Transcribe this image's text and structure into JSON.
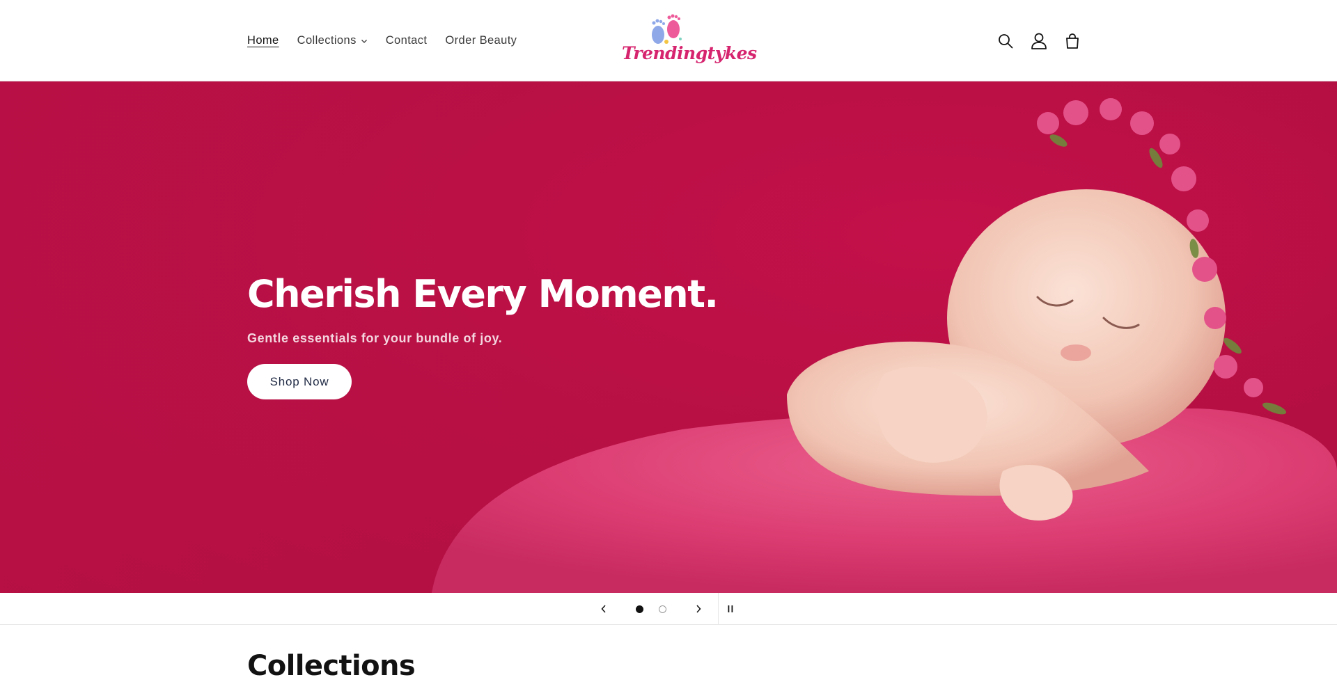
{
  "nav": {
    "items": [
      {
        "label": "Home",
        "active": true
      },
      {
        "label": "Collections",
        "dropdown": true
      },
      {
        "label": "Contact"
      },
      {
        "label": "Order Beauty"
      }
    ]
  },
  "logo": {
    "text": "Trendingtykes"
  },
  "header_icons": [
    "search-icon",
    "account-icon",
    "cart-icon"
  ],
  "hero": {
    "title": "Cherish Every Moment.",
    "subtitle": "Gentle essentials for your bundle of joy.",
    "button_label": "Shop Now"
  },
  "slider": {
    "slide_count": 2,
    "active_slide": 1,
    "controls": [
      "chevron-left-icon",
      "chevron-right-icon",
      "pause-icon"
    ]
  },
  "collections": {
    "title": "Collections"
  },
  "colors": {
    "hero_bg": "#b50f43",
    "brand_pink": "#d6246e",
    "text": "#121212"
  }
}
